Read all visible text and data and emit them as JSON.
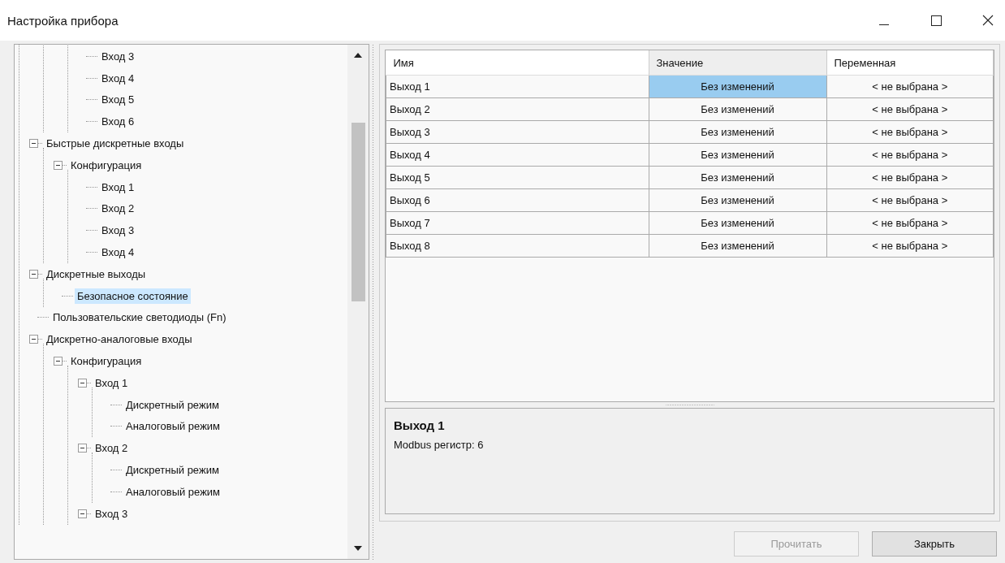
{
  "window": {
    "title": "Настройка прибора"
  },
  "tree": {
    "items": [
      {
        "children": [
          {
            "children": [
              {
                "children": [
                  {
                    "label": "Вход 3",
                    "selected": false
                  },
                  {
                    "label": "Вход 4",
                    "selected": false
                  },
                  {
                    "label": "Вход 5",
                    "selected": false
                  },
                  {
                    "label": "Вход 6",
                    "selected": false
                  }
                ]
              }
            ]
          },
          {
            "label": "Быстрые дискретные входы",
            "selected": false,
            "expanded": true,
            "children": [
              {
                "label": "Конфигурация",
                "selected": false,
                "expanded": true,
                "children": [
                  {
                    "label": "Вход 1",
                    "selected": false
                  },
                  {
                    "label": "Вход 2",
                    "selected": false
                  },
                  {
                    "label": "Вход 3",
                    "selected": false
                  },
                  {
                    "label": "Вход 4",
                    "selected": false
                  }
                ]
              }
            ]
          },
          {
            "label": "Дискретные выходы",
            "selected": false,
            "expanded": true,
            "children": [
              {
                "label": "Безопасное состояние",
                "selected": true
              }
            ]
          },
          {
            "label": "Пользовательские светодиоды (Fn)",
            "selected": false
          },
          {
            "label": "Дискретно-аналоговые входы",
            "selected": false,
            "expanded": true,
            "children": [
              {
                "label": "Конфигурация",
                "selected": false,
                "expanded": true,
                "children": [
                  {
                    "label": "Вход 1",
                    "selected": false,
                    "expanded": true,
                    "children": [
                      {
                        "label": "Дискретный режим",
                        "selected": false
                      },
                      {
                        "label": "Аналоговый режим",
                        "selected": false
                      }
                    ]
                  },
                  {
                    "label": "Вход 2",
                    "selected": false,
                    "expanded": true,
                    "children": [
                      {
                        "label": "Дискретный режим",
                        "selected": false
                      },
                      {
                        "label": "Аналоговый режим",
                        "selected": false
                      }
                    ]
                  },
                  {
                    "label": "Вход 3",
                    "selected": false,
                    "expanded": true
                  }
                ]
              }
            ]
          }
        ]
      }
    ]
  },
  "table": {
    "columns": [
      "Имя",
      "Значение",
      "Переменная"
    ],
    "rows": [
      {
        "name": "Выход 1",
        "value": "Без изменений",
        "variable": "< не выбрана >",
        "selected": true
      },
      {
        "name": "Выход 2",
        "value": "Без изменений",
        "variable": "< не выбрана >",
        "selected": false
      },
      {
        "name": "Выход 3",
        "value": "Без изменений",
        "variable": "< не выбрана >",
        "selected": false
      },
      {
        "name": "Выход 4",
        "value": "Без изменений",
        "variable": "< не выбрана >",
        "selected": false
      },
      {
        "name": "Выход 5",
        "value": "Без изменений",
        "variable": "< не выбрана >",
        "selected": false
      },
      {
        "name": "Выход 6",
        "value": "Без изменений",
        "variable": "< не выбрана >",
        "selected": false
      },
      {
        "name": "Выход 7",
        "value": "Без изменений",
        "variable": "< не выбрана >",
        "selected": false
      },
      {
        "name": "Выход 8",
        "value": "Без изменений",
        "variable": "< не выбрана >",
        "selected": false
      }
    ]
  },
  "info": {
    "title": "Выход 1",
    "description": "Modbus регистр: 6"
  },
  "buttons": [
    {
      "label": "Прочитать",
      "disabled": true
    },
    {
      "label": "Закрыть",
      "disabled": false
    }
  ]
}
